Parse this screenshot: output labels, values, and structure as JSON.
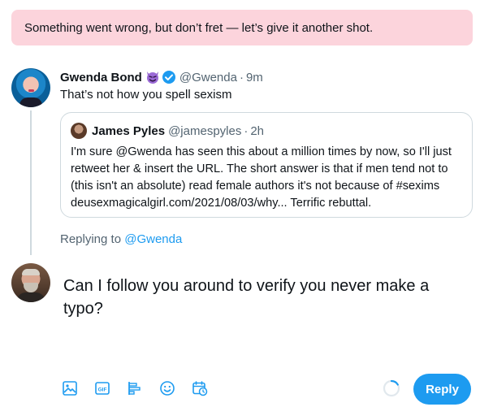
{
  "error_banner": {
    "text": "Something went wrong, but don’t fret — let’s give it another shot."
  },
  "tweet": {
    "display_name": "Gwenda Bond",
    "handle": "@Gwenda",
    "separator": "·",
    "time": "9m",
    "text": "That’s not how you spell sexism",
    "icons": [
      "smiling-devil-emoji",
      "verified-badge-icon"
    ]
  },
  "quote": {
    "display_name": "James Pyles",
    "handle": "@jamespyles",
    "separator": "·",
    "time": "2h",
    "text": "I'm sure @Gwenda has seen this about a million times by now, so I'll just retweet her & insert the URL. The short answer is that if men tend not to (this isn't an absolute) read female authors it's not because of #sexims deusexmagicalgirl.com/2021/08/03/why... Terrific rebuttal."
  },
  "replying": {
    "prefix": "Replying to",
    "mention": "@Gwenda"
  },
  "composer": {
    "text": "Can I follow you around to verify you never make a typo?",
    "reply_button": "Reply",
    "accent_color": "#1d9bf0",
    "tools": [
      "media-icon",
      "gif-icon",
      "poll-icon",
      "emoji-icon",
      "schedule-icon"
    ]
  }
}
